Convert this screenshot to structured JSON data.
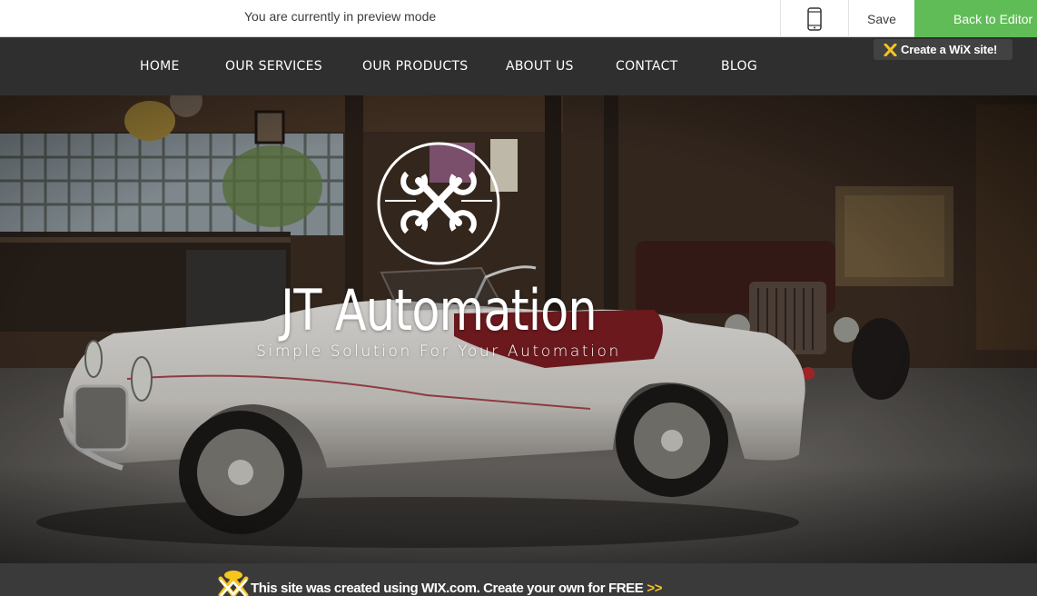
{
  "preview_bar": {
    "message": "You are currently in preview mode",
    "mobile_icon": "mobile-phone-icon",
    "save_label": "Save",
    "back_label": "Back to Editor",
    "accent_color": "#60bc57"
  },
  "nav": {
    "items": [
      {
        "label": "HOME"
      },
      {
        "label": "OUR SERVICES"
      },
      {
        "label": "OUR PRODUCTS"
      },
      {
        "label": "ABOUT US"
      },
      {
        "label": "CONTACT"
      },
      {
        "label": "BLOG"
      }
    ],
    "wix_badge": {
      "icon": "wix-logo-icon",
      "label": "Create a WiX site!"
    }
  },
  "hero": {
    "logo_icon": "crossed-wrenches-icon",
    "title": "JT Automation",
    "subtitle": "Simple Solution For Your Automation",
    "background": "vintage-car-garage-photo"
  },
  "footer": {
    "icon": "wix-crown-icon",
    "text": "This site was created using WIX.com. Create your own for FREE",
    "arrows": ">>",
    "arrow_color": "#f7c520"
  }
}
